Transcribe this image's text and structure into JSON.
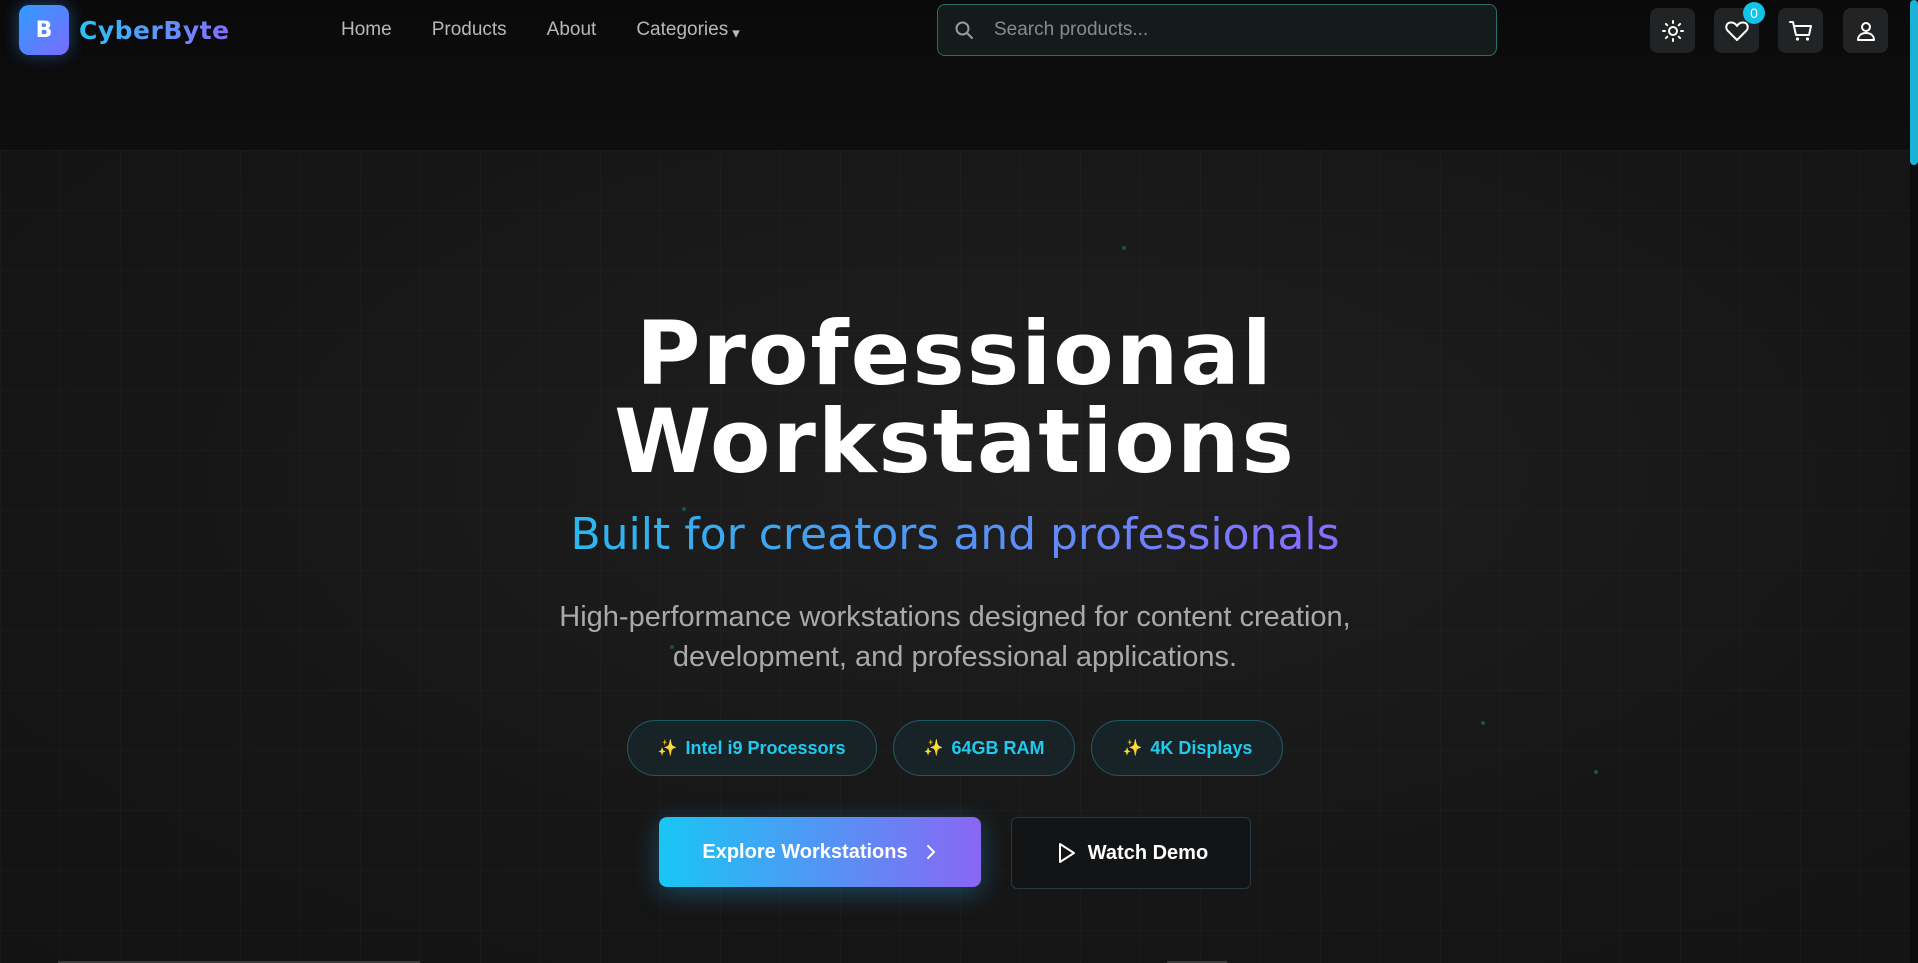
{
  "brand": {
    "logo_letter": "B",
    "name": "CyberByte"
  },
  "nav": {
    "links": [
      "Home",
      "Products",
      "About",
      "Categories"
    ],
    "categories_caret": "▾"
  },
  "search": {
    "placeholder": "Search products..."
  },
  "header_icons": {
    "theme_toggle": "sun-icon",
    "wishlist": "heart-icon",
    "wishlist_count": "0",
    "cart": "cart-icon",
    "account": "user-icon"
  },
  "hero": {
    "title_line1": "Professional",
    "title_line2": "Workstations",
    "subtitle": "Built for creators and professionals",
    "description": "High-performance workstations designed for content creation, development, and professional applications.",
    "chips": [
      {
        "icon": "✨",
        "label": "Intel i9 Processors"
      },
      {
        "icon": "✨",
        "label": "64GB RAM"
      },
      {
        "icon": "✨",
        "label": "4K Displays"
      }
    ],
    "primary_cta": "Explore Workstations",
    "secondary_cta": "Watch Demo"
  },
  "colors": {
    "accent_cyan": "#19c6f4",
    "accent_purple": "#8a66f5",
    "background": "#0d0d0d"
  }
}
